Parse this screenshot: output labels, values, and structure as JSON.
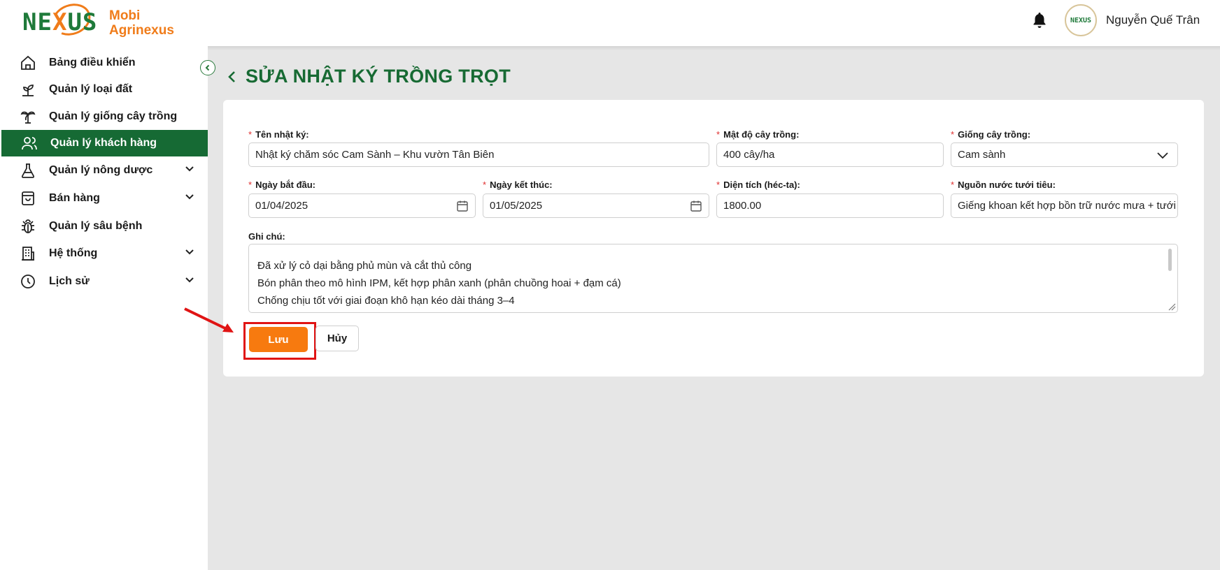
{
  "brand": {
    "logo_word_pre": "NE",
    "logo_word_x": "X",
    "logo_word_post": "US",
    "subtitle_line1": "Mobi",
    "subtitle_line2": "Agrinexus",
    "avatar_text": "NEXUS"
  },
  "header": {
    "user_name": "Nguyễn Quế Trân"
  },
  "sidebar": {
    "items": [
      {
        "label": "Bảng điều khiển",
        "icon": "home-icon"
      },
      {
        "label": "Quản lý loại đất",
        "icon": "sprout-icon"
      },
      {
        "label": "Quản lý giống cây trồng",
        "icon": "palm-tree-icon"
      },
      {
        "label": "Quản lý khách hàng",
        "icon": "users-icon",
        "active": true
      },
      {
        "label": "Quản lý nông dược",
        "icon": "flask-icon",
        "expandable": true
      },
      {
        "label": "Bán hàng",
        "icon": "shopping-bag-icon",
        "expandable": true
      },
      {
        "label": "Quản lý sâu bệnh",
        "icon": "bug-icon"
      },
      {
        "label": "Hệ thống",
        "icon": "building-icon",
        "expandable": true
      },
      {
        "label": "Lịch sử",
        "icon": "clock-icon",
        "expandable": true
      }
    ]
  },
  "page": {
    "title": "SỬA NHẬT KÝ TRỒNG TRỌT"
  },
  "form": {
    "required_mark": "*",
    "journal_name": {
      "label": "Tên nhật ký:",
      "value": "Nhật ký chăm sóc Cam Sành – Khu vườn Tân Biên"
    },
    "density": {
      "label": "Mật độ cây trồng:",
      "value": "400 cây/ha"
    },
    "variety": {
      "label": "Giống cây trồng:",
      "value": "Cam sành"
    },
    "start_date": {
      "label": "Ngày bắt đầu:",
      "value": "01/04/2025"
    },
    "end_date": {
      "label": "Ngày kết thúc:",
      "value": "01/05/2025"
    },
    "area": {
      "label": "Diện tích (héc-ta):",
      "value": "1800.00"
    },
    "water_source": {
      "label": "Nguồn nước tưới tiêu:",
      "value": "Giếng khoan kết hợp bồn trữ nước mưa + tưới nhỏ giọt"
    },
    "notes": {
      "label": "Ghi chú:",
      "lines": [
        "Đã xử lý cỏ dại bằng phủ mùn và cắt thủ công",
        "Bón phân theo mô hình IPM, kết hợp phân xanh (phân chuồng hoai + đạm cá)",
        "Chống chịu tốt với giai đoạn khô hạn kéo dài tháng 3–4"
      ]
    },
    "save_label": "Lưu",
    "cancel_label": "Hủy"
  },
  "colors": {
    "brand_green": "#176a33",
    "accent_orange": "#f77a0f",
    "highlight_red": "#e01414",
    "content_bg": "#e6e6e6"
  }
}
